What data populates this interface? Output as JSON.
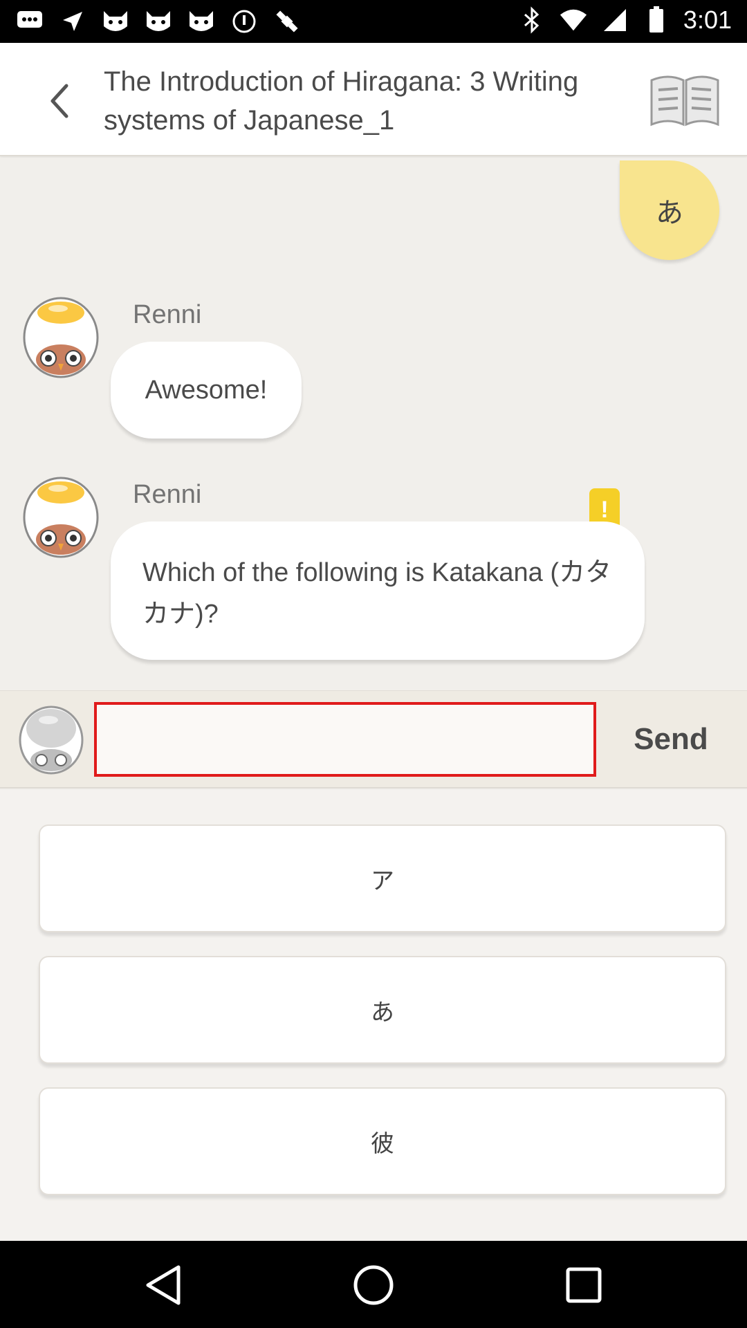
{
  "status_bar": {
    "time": "3:01",
    "icons": [
      "chat-bubble-icon",
      "navigation-arrow-icon",
      "cat-face-icon",
      "cat-face-icon",
      "cat-face-icon",
      "vpn-key-icon",
      "fake-gps-satellite-icon",
      "bluetooth-icon",
      "wifi-icon",
      "signal-icon",
      "battery-icon"
    ]
  },
  "header": {
    "title": "The Introduction of Hiragana: 3 Writing systems of Japanese_1",
    "back_icon": "chevron-left-icon",
    "book_icon": "open-book-icon"
  },
  "chat": {
    "hint_char": "あ",
    "messages": [
      {
        "sender": "Renni",
        "text": "Awesome!"
      },
      {
        "sender": "Renni",
        "text": "Which of the following is Katakana (カタカナ)?",
        "badge": "!"
      }
    ]
  },
  "input": {
    "value": "",
    "placeholder": "",
    "send_label": "Send"
  },
  "options": [
    "ア",
    "あ",
    "彼"
  ],
  "nav_bar": {
    "icons": [
      "back-triangle-icon",
      "home-circle-icon",
      "recents-square-icon"
    ]
  },
  "colors": {
    "accent_yellow": "#f8e48e",
    "badge_yellow": "#f5cf27",
    "input_border": "#e01b1b",
    "chat_background": "#f1efeb"
  }
}
